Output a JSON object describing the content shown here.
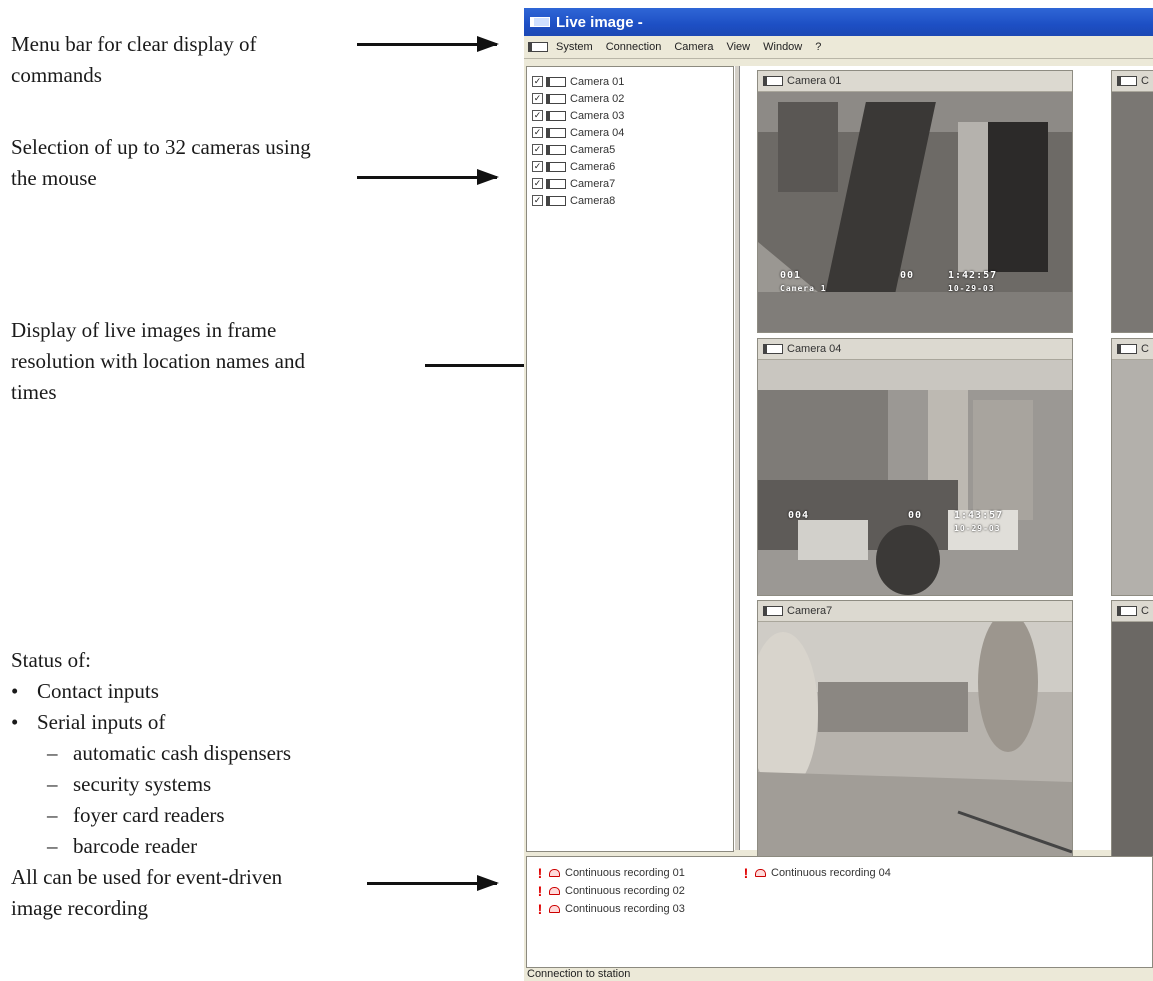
{
  "annotations": {
    "menu": [
      "Menu bar for clear display of",
      "commands"
    ],
    "selection": [
      "Selection of up to 32 cameras using",
      "the mouse"
    ],
    "display": [
      "Display of live images in frame",
      "resolution with location names and",
      "times"
    ],
    "status": {
      "heading": "Status of:",
      "bullet_mark": "•",
      "dash_mark": "–",
      "items": [
        "Contact inputs",
        "Serial inputs of"
      ],
      "subitems": [
        "automatic cash dispensers",
        "security systems",
        "foyer card readers",
        "barcode reader"
      ],
      "footer": [
        "All can be used for event-driven",
        "image recording"
      ]
    }
  },
  "window": {
    "title": "Live image -",
    "menu": [
      "System",
      "Connection",
      "Camera",
      "View",
      "Window",
      "?"
    ],
    "camera_list": [
      "Camera 01",
      "Camera 02",
      "Camera 03",
      "Camera 04",
      "Camera5",
      "Camera6",
      "Camera7",
      "Camera8"
    ],
    "check_mark": "✓",
    "tiles": {
      "t1": {
        "label": "Camera 01",
        "osd_id": "001",
        "osd_name": "Camera 1",
        "osd_num": "00",
        "osd_time": "1:42:57",
        "osd_date": "10-29-03"
      },
      "t2": {
        "label": "Camera 04",
        "osd_id": "004",
        "osd_num": "00",
        "osd_time": "1:43:57",
        "osd_date": "10-29-03"
      },
      "t3": {
        "label": "Camera7"
      },
      "partial_label": "C"
    },
    "events": [
      "Continuous recording 01",
      "Continuous recording 02",
      "Continuous recording 03",
      "Continuous recording 04"
    ],
    "event_mark": "!",
    "status_bar": "Connection to station"
  },
  "colors": {
    "titlebar": "#1d4fc4",
    "alarm": "#e00000",
    "window_bg": "#ece9d8"
  }
}
